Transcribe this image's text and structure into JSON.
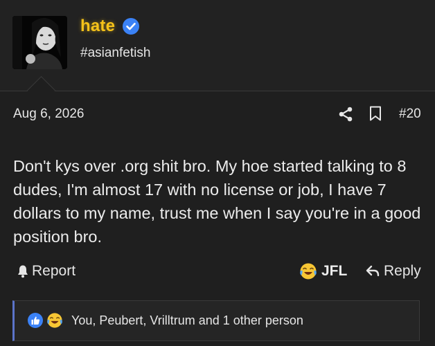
{
  "user": {
    "username": "hate",
    "title": "#asianfetish",
    "username_color": "#f5c21a",
    "verified_icon": "verified-check-icon"
  },
  "post": {
    "date": "Aug 6, 2026",
    "number": "#20",
    "body": "Don't kys over .org shit bro. My hoe started talking to 8 dudes, I'm almost 17 with no license or job, I have 7 dollars to my name, trust me when I say you're in a good position bro.",
    "share_icon": "share-icon",
    "bookmark_icon": "bookmark-icon"
  },
  "actions": {
    "report_label": "Report",
    "reaction_label": "JFL",
    "reply_label": "Reply"
  },
  "reactions": {
    "summary": "You, Peubert, Vrilltrum and 1 other person",
    "icons": [
      "like-icon",
      "laughing-crying-icon"
    ]
  },
  "colors": {
    "background": "#1f1f1f",
    "accent": "#5b74c9",
    "verified": "#3b82f6"
  }
}
